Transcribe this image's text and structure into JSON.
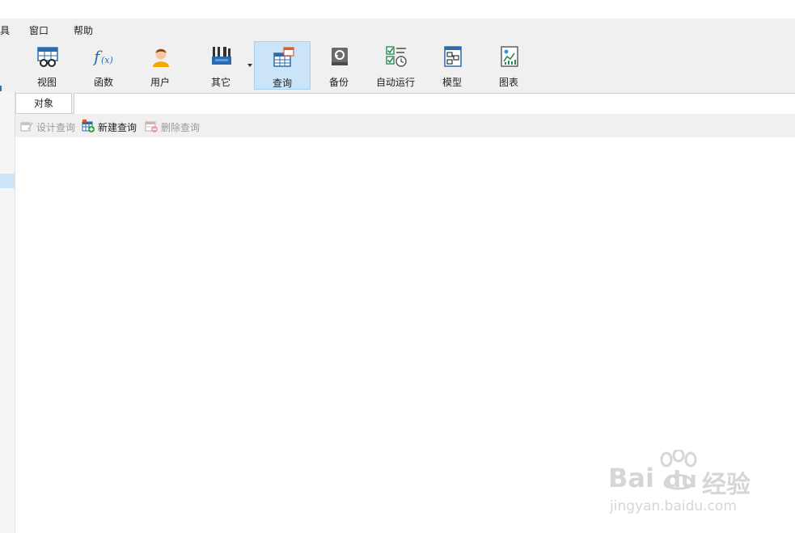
{
  "menu": {
    "items": [
      "具",
      "窗口",
      "帮助"
    ]
  },
  "toolbar": {
    "buttons": [
      {
        "label": "视图",
        "icon": "view-icon"
      },
      {
        "label": "函数",
        "icon": "function-icon"
      },
      {
        "label": "用户",
        "icon": "user-icon"
      },
      {
        "label": "其它",
        "icon": "tools-icon"
      },
      {
        "label": "查询",
        "icon": "query-icon"
      },
      {
        "label": "备份",
        "icon": "backup-icon"
      },
      {
        "label": "自动运行",
        "icon": "automation-icon"
      },
      {
        "label": "模型",
        "icon": "model-icon"
      },
      {
        "label": "图表",
        "icon": "chart-icon"
      }
    ],
    "active": "查询"
  },
  "tabs": {
    "object_label": "对象"
  },
  "object_toolbar": {
    "design_query": "设计查询",
    "new_query": "新建查询",
    "delete_query": "删除查询"
  },
  "watermark": {
    "brand": "Bai",
    "brand2": "du",
    "cn": "经验",
    "url": "jingyan.baidu.com"
  },
  "colors": {
    "active_bg": "#cce4f7",
    "toolbar_bg": "#f0f0f0",
    "accent": "#3a6ea5"
  }
}
